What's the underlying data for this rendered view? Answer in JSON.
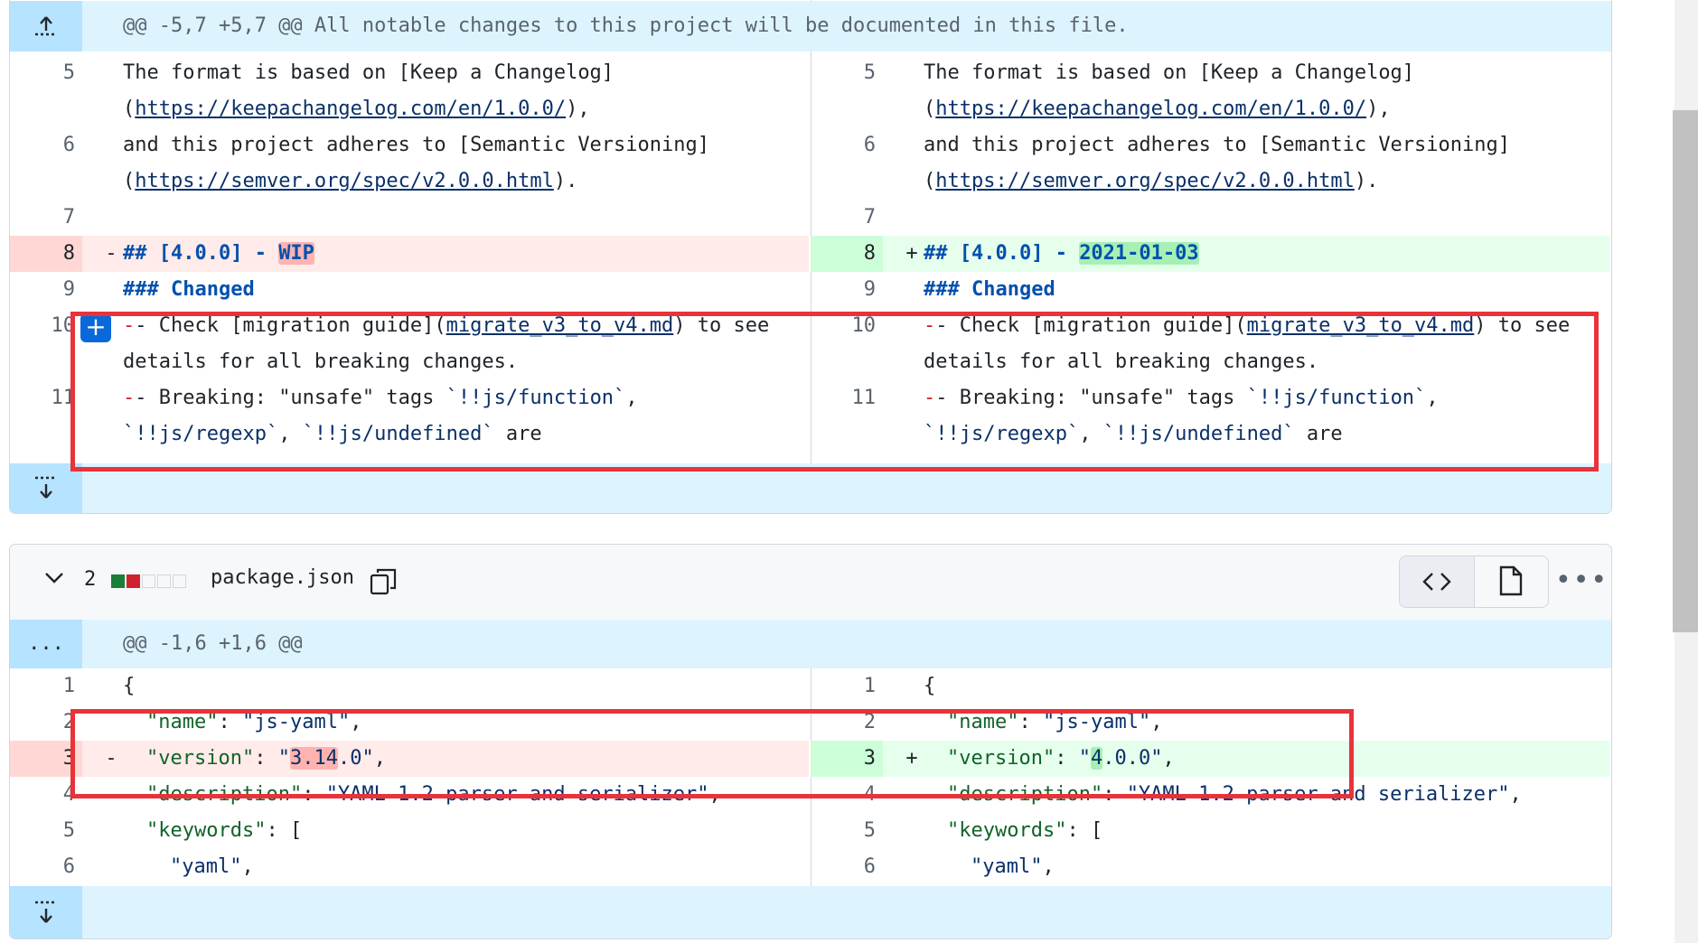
{
  "file1": {
    "hunk_header": "@@ -5,7 +5,7 @@ All notable changes to this project will be documented in this file.",
    "rows": [
      {
        "ln": "5",
        "text_a": "The format is based on [Keep a Changelog]",
        "text_b_pre": "(",
        "link": "https://keepachangelog.com/en/1.0.0/",
        "text_b_post": "),"
      },
      {
        "ln": "6",
        "text_a": "and this project adheres to [Semantic Versioning]",
        "text_b_pre": "(",
        "link": "https://semver.org/spec/v2.0.0.html",
        "text_b_post": ")."
      },
      {
        "ln": "7"
      },
      {
        "ln": "8"
      },
      {
        "ln": "9",
        "text": "### Changed"
      },
      {
        "ln": "10",
        "pre": "- Check [migration guide](",
        "link": "migrate_v3_to_v4.md",
        "post": ") to see",
        "line2": "details for all breaking changes."
      },
      {
        "ln": "11",
        "pre": "- Breaking: \"unsafe\" tags ",
        "t1": "`!!js/function`",
        "sep": ",",
        "t2": "`!!js/regexp`",
        "sep2": ", ",
        "t3": "`!!js/undefined`",
        "post": " are"
      }
    ],
    "del_line": {
      "sign": "-",
      "prefix": "## [4.0.0] - ",
      "changed": "WIP"
    },
    "add_line": {
      "sign": "+",
      "prefix": "## [4.0.0] - ",
      "changed": "2021-01-03"
    }
  },
  "file2": {
    "expand_count": "2",
    "filename": "package.json",
    "hunk_header": "@@ -1,6 +1,6 @@",
    "expand_label": "...",
    "lines": [
      {
        "ln": "1",
        "text": "{"
      },
      {
        "ln": "2",
        "key": "\"name\"",
        "colon": ": ",
        "value": "\"js-yaml\"",
        "tail": ","
      },
      {
        "ln": "4",
        "key": "\"description\"",
        "colon": ": ",
        "value": "\"YAML 1.2 parser and serializer\"",
        "tail": ","
      },
      {
        "ln": "5",
        "key": "\"keywords\"",
        "colon": ": ",
        "tail": "["
      },
      {
        "ln": "6",
        "value": "\"yaml\"",
        "tail": ","
      }
    ],
    "del_line": {
      "ln": "3",
      "sign": "-",
      "key": "\"version\"",
      "colon": ": ",
      "v_pre": "\"",
      "changed": "3.14",
      "v_post": ".0\"",
      "tail": ","
    },
    "add_line": {
      "ln": "3",
      "sign": "+",
      "key": "\"version\"",
      "colon": ": ",
      "v_pre": "\"",
      "changed": "4",
      "v_post": ".0.0\"",
      "tail": ","
    }
  },
  "colors": {
    "highlight_box": "#e8333a",
    "deleted": "#ffebe9",
    "added": "#e6ffec",
    "hunk": "#ddf4ff",
    "accent": "#0969da"
  },
  "icons": [
    "expand-up-icon",
    "expand-down-icon",
    "plus-icon",
    "chevron-down-icon",
    "copy-icon",
    "code-icon",
    "file-icon",
    "kebab-icon"
  ]
}
